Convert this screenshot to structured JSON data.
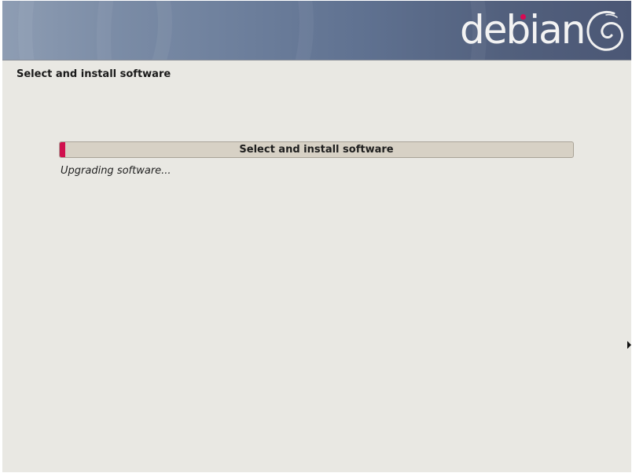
{
  "banner": {
    "logo_text": "debian",
    "logo_icon": "debian-swirl-icon",
    "accent_color": "#d70a53"
  },
  "page": {
    "title": "Select and install software"
  },
  "progress": {
    "label": "Select and install software",
    "fraction": 0.01,
    "fill_color": "#d0104e",
    "status_text": "Upgrading software..."
  },
  "pointer": {
    "icon": "mouse-pointer-icon"
  }
}
